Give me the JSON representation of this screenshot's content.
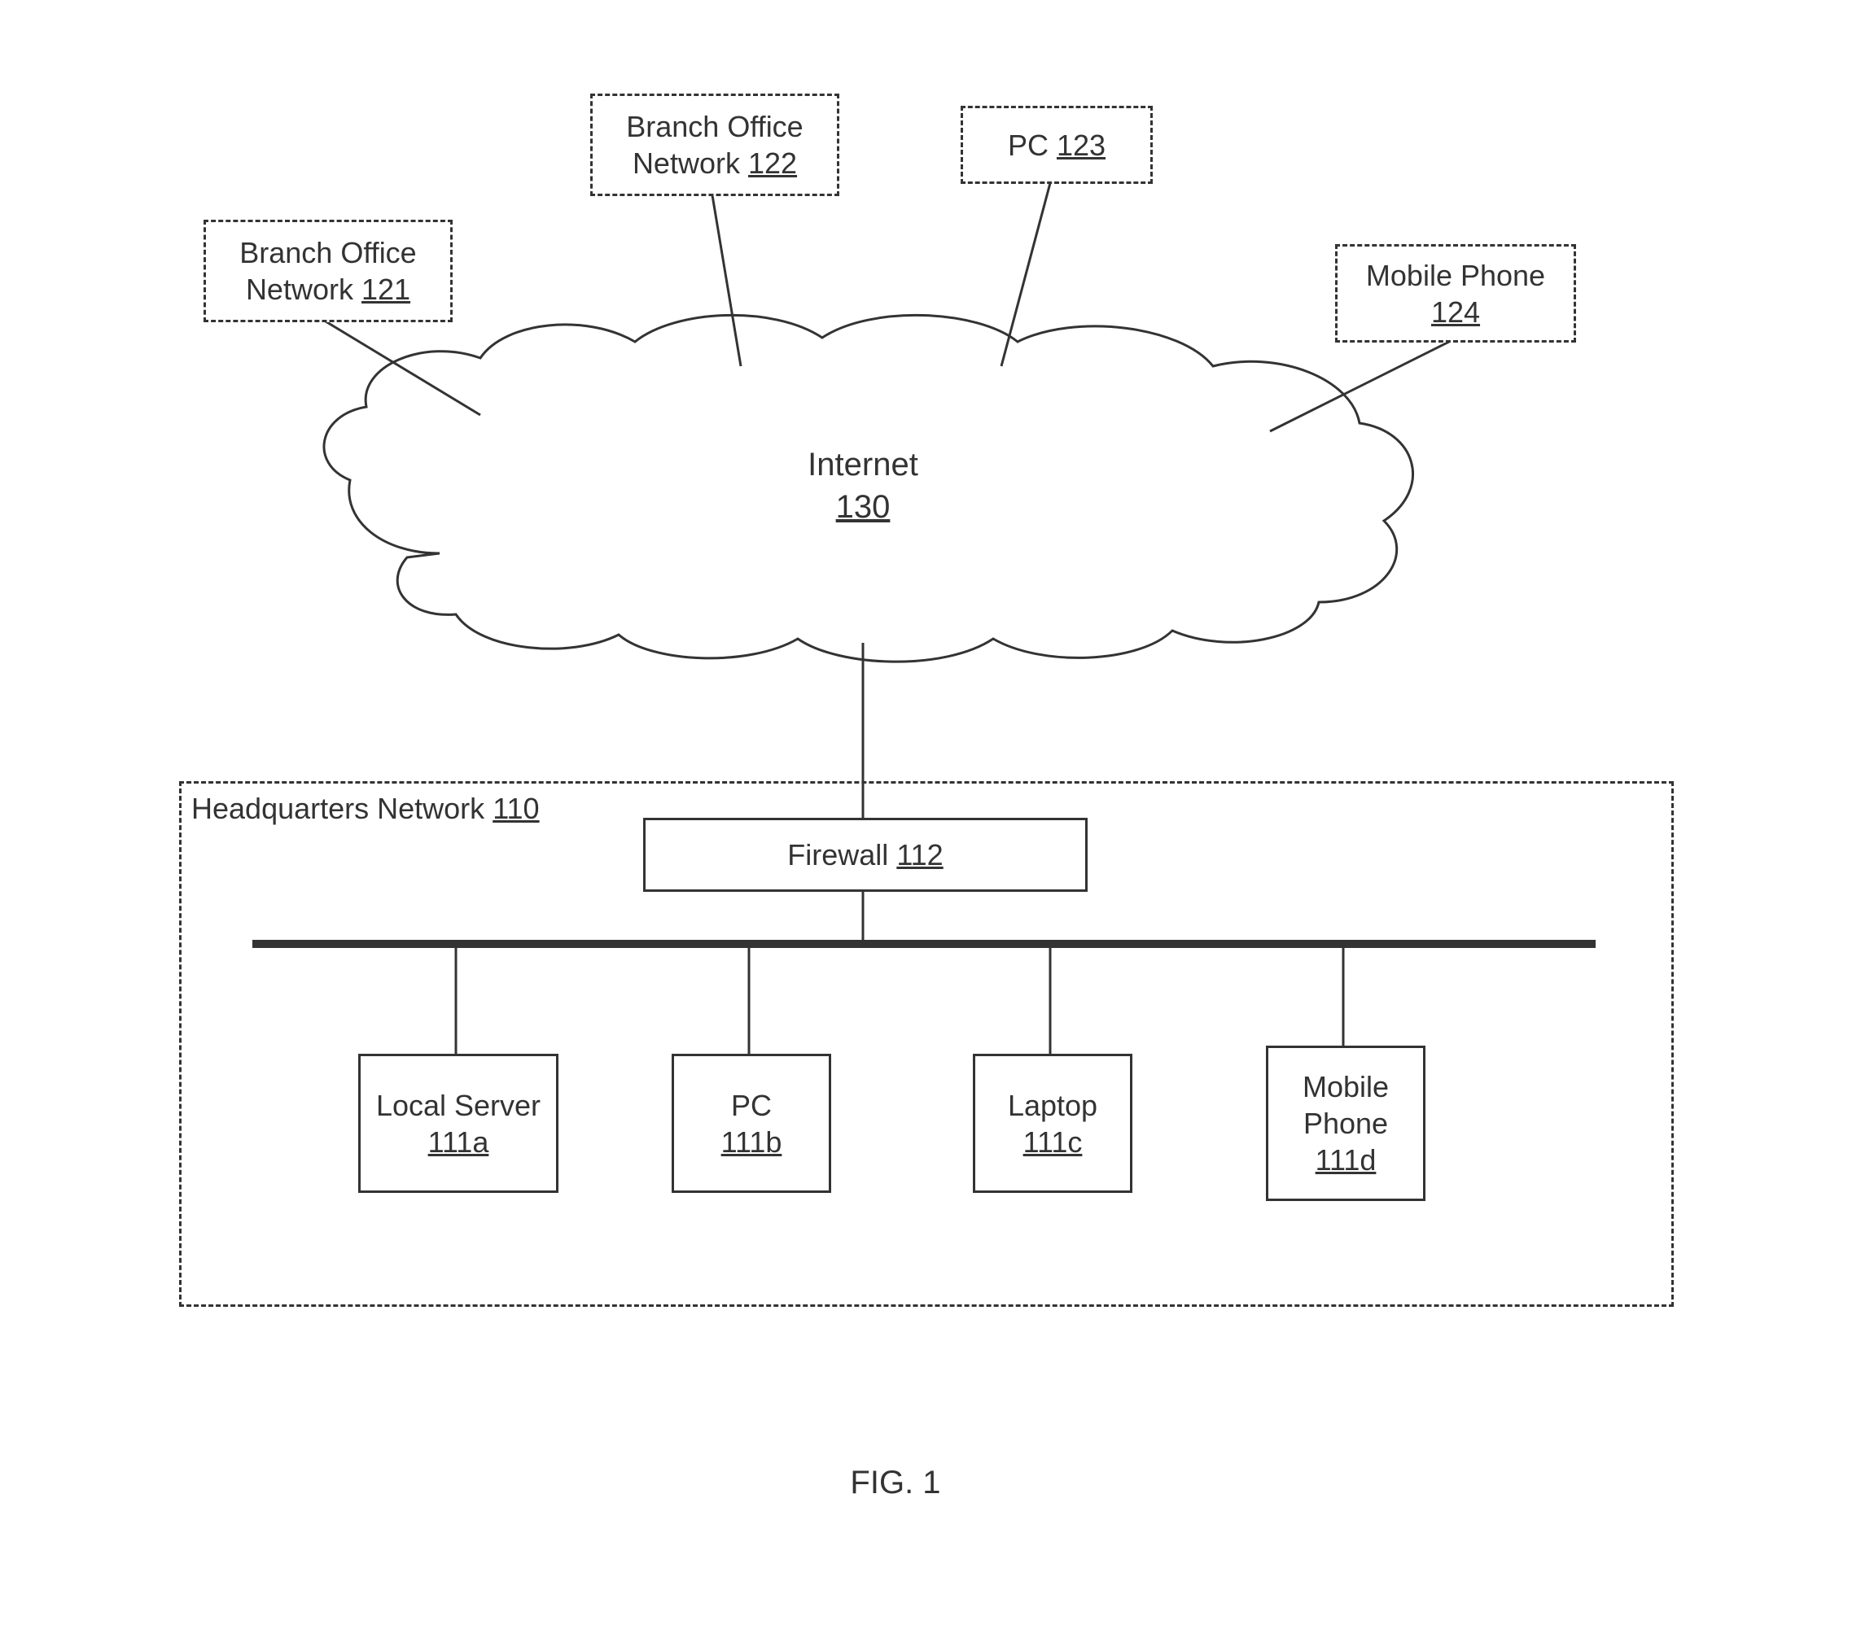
{
  "figure_caption": "FIG. 1",
  "cloud": {
    "name": "Internet",
    "ref": "130"
  },
  "top_nodes": {
    "branch1": {
      "name": "Branch Office Network",
      "ref": "121"
    },
    "branch2": {
      "name": "Branch Office Network",
      "ref": "122"
    },
    "pc": {
      "name": "PC",
      "ref": "123"
    },
    "mobile": {
      "name": "Mobile Phone",
      "ref": "124"
    }
  },
  "hq": {
    "container": {
      "name": "Headquarters Network",
      "ref": "110"
    },
    "firewall": {
      "name": "Firewall",
      "ref": "112"
    },
    "devices": {
      "server": {
        "name": "Local Server",
        "ref": "111a"
      },
      "pc": {
        "name": "PC",
        "ref": "111b"
      },
      "laptop": {
        "name": "Laptop",
        "ref": "111c"
      },
      "mobile": {
        "name": "Mobile Phone",
        "ref": "111d"
      }
    }
  }
}
